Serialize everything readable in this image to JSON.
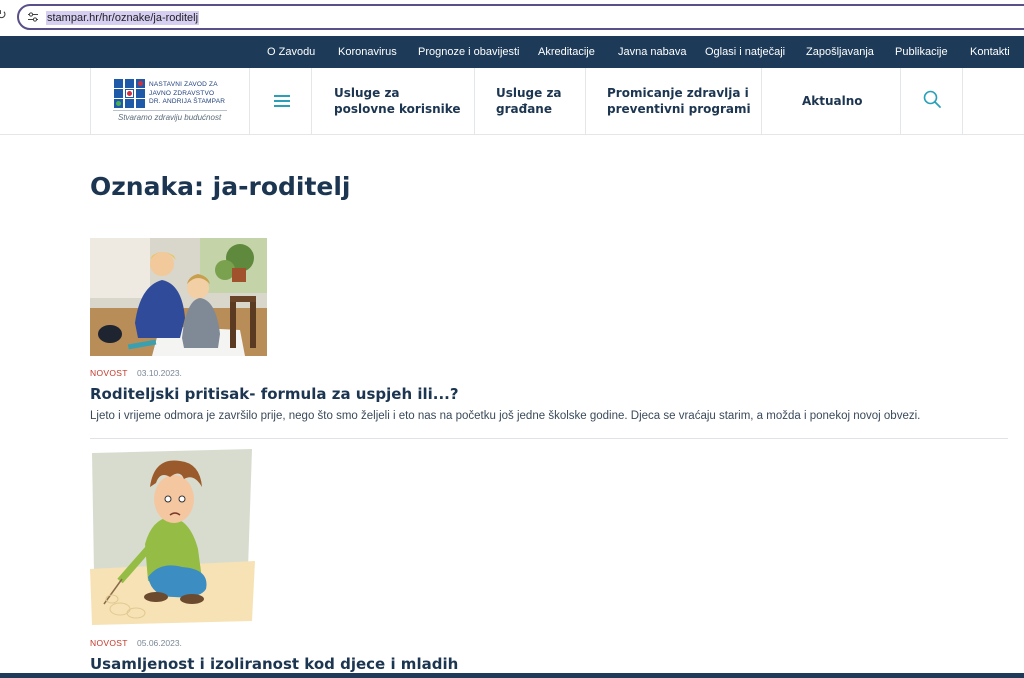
{
  "browser": {
    "url": "stampar.hr/hr/oznake/ja-roditelj"
  },
  "top_nav": [
    {
      "label": "O Zavodu"
    },
    {
      "label": "Koronavirus"
    },
    {
      "label": "Prognoze i obavijesti"
    },
    {
      "label": "Akreditacije"
    },
    {
      "label": "Javna nabava"
    },
    {
      "label": "Oglasi i natječaji"
    },
    {
      "label": "Zapošljavanja"
    },
    {
      "label": "Publikacije"
    },
    {
      "label": "Kontakti"
    }
  ],
  "logo": {
    "line1": "NASTAVNI ZAVOD ZA",
    "line2": "JAVNO ZDRAVSTVO",
    "line3": "DR. ANDRIJA ŠTAMPAR",
    "tagline": "Stvaramo zdraviju budućnost",
    "colors": {
      "blue": "#1e5aa8",
      "red": "#d32f3a",
      "green": "#4caf50"
    }
  },
  "main_nav": [
    {
      "line1": "Usluge za",
      "line2": "poslovne korisnike"
    },
    {
      "line1": "Usluge za",
      "line2": "građane"
    },
    {
      "line1": "Promicanje zdravlja i",
      "line2": "preventivni programi"
    },
    {
      "line1": "Aktualno",
      "line2": ""
    }
  ],
  "icons": {
    "menu": "hamburger-icon",
    "search": "search-icon"
  },
  "page": {
    "title": "Oznaka: ja-roditelj"
  },
  "articles": [
    {
      "category": "NOVOST",
      "date": "03.10.2023.",
      "title": "Roditeljski pritisak- formula za uspjeh ili...?",
      "excerpt": "Ljeto i vrijeme odmora je završilo prije, nego što smo željeli i eto nas na početku još jedne školske godine. Djeca se vraćaju starim, a možda i ponekoj novoj obvezi."
    },
    {
      "category": "NOVOST",
      "date": "05.06.2023.",
      "title": "Usamljenost i izoliranost kod djece i mladih",
      "excerpt": ""
    }
  ],
  "colors": {
    "nav_bg": "#1d3b58",
    "heading": "#1c3550",
    "category": "#c0392b",
    "accent": "#2aa0b8"
  }
}
